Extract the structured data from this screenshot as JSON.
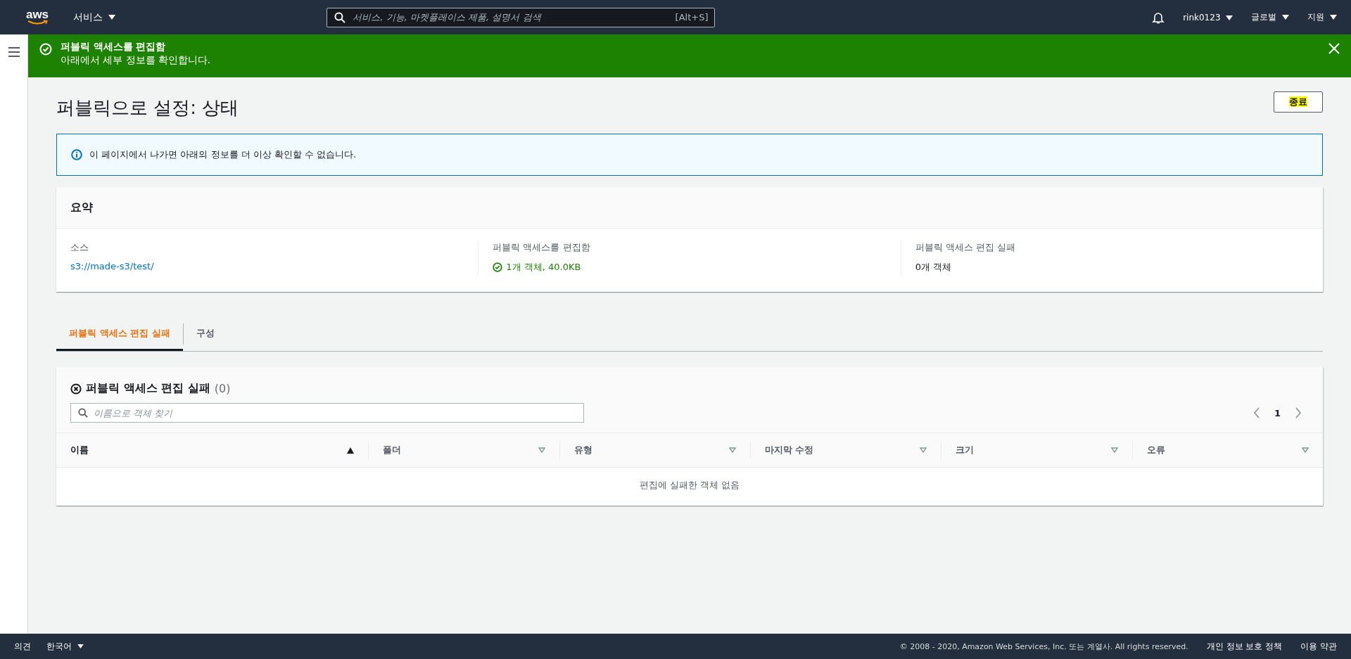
{
  "top_nav": {
    "logo": "aws",
    "services": "서비스",
    "search": {
      "placeholder": "서비스, 기능, 마켓플레이스 제품, 설명서 검색",
      "shortcut": "[Alt+S]"
    },
    "account": "rink0123",
    "region": "글로벌",
    "support": "지원"
  },
  "flash": {
    "title": "퍼블릭 액세스를 편집함",
    "message": "아래에서 세부 정보를 확인합니다."
  },
  "page": {
    "title": "퍼블릭으로 설정: 상태",
    "close_button": {
      "label": "종료",
      "highlighted": true
    }
  },
  "info": "이 페이지에서 나가면 아래의 정보를 더 이상 확인할 수 없습니다.",
  "summary": {
    "title": "요약",
    "items": [
      {
        "label": "소스",
        "value": "s3://made-s3/test/",
        "kind": "link"
      },
      {
        "label": "퍼블릭 액세스를 편집함",
        "value": "1개 객체, 40.0KB",
        "kind": "success"
      },
      {
        "label": "퍼블릭 액세스 편집 실패",
        "value": "0개 객체",
        "kind": "plain"
      }
    ]
  },
  "tabs": [
    {
      "label": "퍼블릭 액세스 편집 실패",
      "selected": true
    },
    {
      "label": "구성",
      "selected": false
    }
  ],
  "failed_table": {
    "title": "퍼블릭 액세스 편집 실패",
    "count": "(0)",
    "search_placeholder": "이름으로 객체 찾기",
    "page": "1",
    "columns": [
      {
        "label": "이름",
        "sorted": true
      },
      {
        "label": "폴더",
        "sorted": false
      },
      {
        "label": "유형",
        "sorted": false
      },
      {
        "label": "마지막 수정",
        "sorted": false
      },
      {
        "label": "크기",
        "sorted": false
      },
      {
        "label": "오류",
        "sorted": false
      }
    ],
    "empty": "편집에 실패한 객체 없음"
  },
  "footer": {
    "feedback": "의견",
    "language": "한국어",
    "copyright": "© 2008 - 2020, Amazon Web Services, Inc. 또는 계열사. All rights reserved.",
    "privacy": "개인 정보 보호 정책",
    "terms": "이용 약관"
  }
}
